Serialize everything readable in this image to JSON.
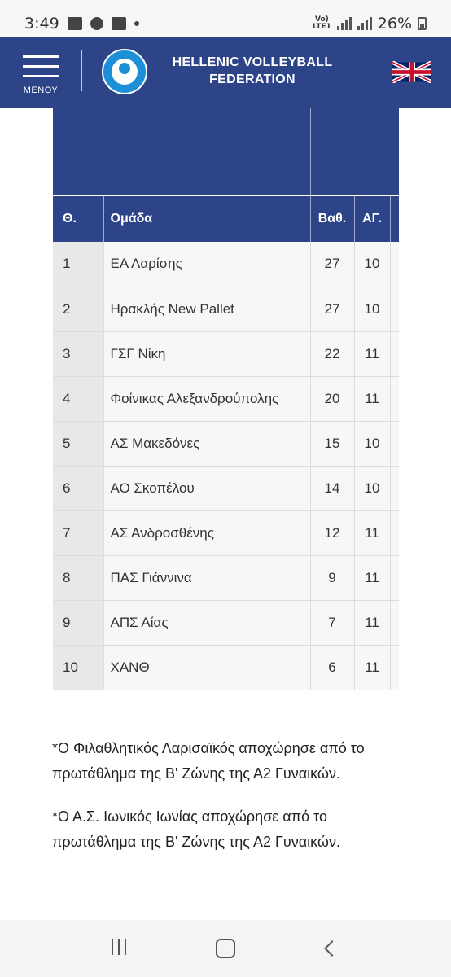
{
  "status_bar": {
    "time": "3:49",
    "network": "VoLTE1 5G",
    "battery": "26%"
  },
  "header": {
    "menu_label": "ΜΕΝΟΥ",
    "title_line1": "HELLENIC VOLLEYBALL",
    "title_line2": "FEDERATION"
  },
  "standings": {
    "columns": [
      "Θ.",
      "Ομάδα",
      "Βαθ.",
      "ΑΓ."
    ],
    "rows": [
      {
        "pos": "1",
        "team": "ΕΑ Λαρίσης",
        "points": "27",
        "games": "10"
      },
      {
        "pos": "2",
        "team": "Ηρακλής New Pallet",
        "points": "27",
        "games": "10"
      },
      {
        "pos": "3",
        "team": "ΓΣΓ Νίκη",
        "points": "22",
        "games": "11"
      },
      {
        "pos": "4",
        "team": "Φοίνικας Αλεξανδρούπολης",
        "points": "20",
        "games": "11"
      },
      {
        "pos": "5",
        "team": "ΑΣ Μακεδόνες",
        "points": "15",
        "games": "10"
      },
      {
        "pos": "6",
        "team": "ΑΟ Σκοπέλου",
        "points": "14",
        "games": "10"
      },
      {
        "pos": "7",
        "team": "ΑΣ Ανδροσθένης",
        "points": "12",
        "games": "11"
      },
      {
        "pos": "8",
        "team": "ΠΑΣ Γιάννινα",
        "points": "9",
        "games": "11"
      },
      {
        "pos": "9",
        "team": "ΑΠΣ Αίας",
        "points": "7",
        "games": "11"
      },
      {
        "pos": "10",
        "team": "ΧΑΝΘ",
        "points": "6",
        "games": "11"
      }
    ]
  },
  "notes": [
    "*Ο Φιλαθλητικός Λαρισαϊκός αποχώρησε από το πρωτάθλημα της Β' Ζώνης της Α2 Γυναικών.",
    "*Ο Α.Σ. Ιωνικός Ιωνίας αποχώρησε από το πρωτάθλημα της Β' Ζώνης της Α2 Γυναικών."
  ],
  "colors": {
    "header_bg": "#2e4489",
    "rank_cell_bg": "#e8e8e8",
    "row_bg": "#f7f7f7"
  }
}
